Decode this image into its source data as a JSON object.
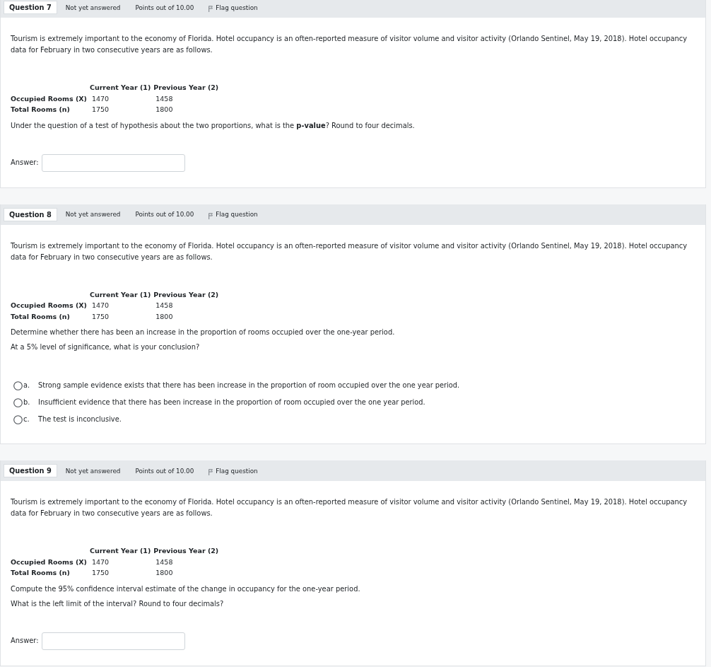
{
  "questions": [
    {
      "kind": "numeric",
      "number": "Question 7",
      "status": "Not yet answered",
      "points": "Points out of 10.00",
      "flag_label": "Flag question",
      "intro": "Tourism is extremely important to the economy of Florida. Hotel occupancy is an often-reported measure of visitor volume and visitor activity (Orlando Sentinel, May 19, 2018). Hotel occupancy data for February in two consecutive years are as follows.",
      "table": {
        "columns": [
          "Current Year (1)",
          "Previous Year (2)"
        ],
        "rows": [
          {
            "label": "Occupied Rooms (X)",
            "values": [
              "1470",
              "1458"
            ]
          },
          {
            "label": "Total Rooms (n)",
            "values": [
              "1750",
              "1800"
            ]
          }
        ]
      },
      "prompts": [
        "Under the question of a test of hypothesis about the two proportions, what is the **p-value**? Round to four decimals."
      ],
      "answer_label": "Answer:"
    },
    {
      "kind": "multichoice",
      "number": "Question 8",
      "status": "Not yet answered",
      "points": "Points out of 10.00",
      "flag_label": "Flag question",
      "intro": "Tourism is extremely important to the economy of Florida. Hotel occupancy is an often-reported measure of visitor volume and visitor activity (Orlando Sentinel, May 19, 2018). Hotel occupancy data for February in two consecutive years are as follows.",
      "table": {
        "columns": [
          "Current Year (1)",
          "Previous Year (2)"
        ],
        "rows": [
          {
            "label": "Occupied Rooms (X)",
            "values": [
              "1470",
              "1458"
            ]
          },
          {
            "label": "Total Rooms (n)",
            "values": [
              "1750",
              "1800"
            ]
          }
        ]
      },
      "prompts": [
        "Determine whether there has been an increase in the proportion of rooms occupied over the one-year period.",
        "At a 5% level of significance, what is your conclusion?"
      ],
      "options": [
        {
          "letter": "a.",
          "text": "Strong sample evidence exists that there has been increase in the proportion of room occupied over the one year period.",
          "selected": false
        },
        {
          "letter": "b.",
          "text": "Insufficient evidence that there has been increase in the proportion of room occupied over the one year period.",
          "selected": false
        },
        {
          "letter": "c.",
          "text": "The test is inconclusive.",
          "selected": false
        }
      ]
    },
    {
      "kind": "numeric",
      "number": "Question 9",
      "status": "Not yet answered",
      "points": "Points out of 10.00",
      "flag_label": "Flag question",
      "intro": "Tourism is extremely important to the economy of Florida. Hotel occupancy is an often-reported measure of visitor volume and visitor activity (Orlando Sentinel, May 19, 2018). Hotel occupancy data for February in two consecutive years are as follows.",
      "table": {
        "columns": [
          "Current Year (1)",
          "Previous Year (2)"
        ],
        "rows": [
          {
            "label": "Occupied Rooms (X)",
            "values": [
              "1470",
              "1458"
            ]
          },
          {
            "label": "Total Rooms (n)",
            "values": [
              "1750",
              "1800"
            ]
          }
        ]
      },
      "prompts": [
        "Compute the 95% confidence interval estimate of the change in occupancy for the one-year period.",
        "What is the left limit of the interval? Round to four decimals?"
      ],
      "answer_label": "Answer:"
    }
  ]
}
